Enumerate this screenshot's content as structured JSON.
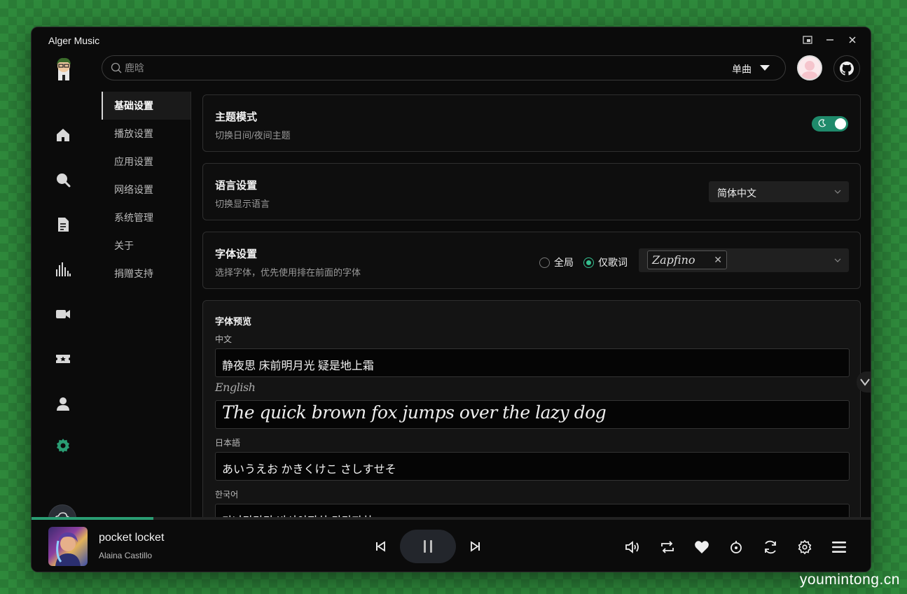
{
  "window": {
    "title": "Alger Music"
  },
  "search": {
    "placeholder": "鹿晗",
    "type_label": "单曲"
  },
  "settings_nav": [
    {
      "label": "基础设置",
      "active": true
    },
    {
      "label": "播放设置",
      "active": false
    },
    {
      "label": "应用设置",
      "active": false
    },
    {
      "label": "网络设置",
      "active": false
    },
    {
      "label": "系统管理",
      "active": false
    },
    {
      "label": "关于",
      "active": false
    },
    {
      "label": "捐赠支持",
      "active": false
    }
  ],
  "theme": {
    "title": "主题模式",
    "subtitle": "切换日间/夜间主题",
    "dark_mode": true
  },
  "language": {
    "title": "语言设置",
    "subtitle": "切换显示语言",
    "selected": "简体中文"
  },
  "font": {
    "title": "字体设置",
    "subtitle": "选择字体，优先使用排在前面的字体",
    "radio_global": "全局",
    "radio_lyrics": "仅歌词",
    "selected_mode": "仅歌词",
    "selected_font": "Zapfino"
  },
  "preview": {
    "title": "字体预览",
    "items": [
      {
        "label": "中文",
        "text": "静夜思 床前明月光 疑是地上霜"
      },
      {
        "label": "English",
        "text": "The quick brown fox jumps over the lazy dog"
      },
      {
        "label": "日本語",
        "text": "あいうえお かきくけこ さしすせそ"
      },
      {
        "label": "한국어",
        "text": "가나다라마 바사아자차 카타파하"
      }
    ]
  },
  "player": {
    "track": "pocket locket",
    "artist": "Alaina Castillo",
    "progress": 0.145
  },
  "colors": {
    "accent": "#2a9d73",
    "background": "#0b0b0b"
  },
  "watermark": "youmintong.cn"
}
